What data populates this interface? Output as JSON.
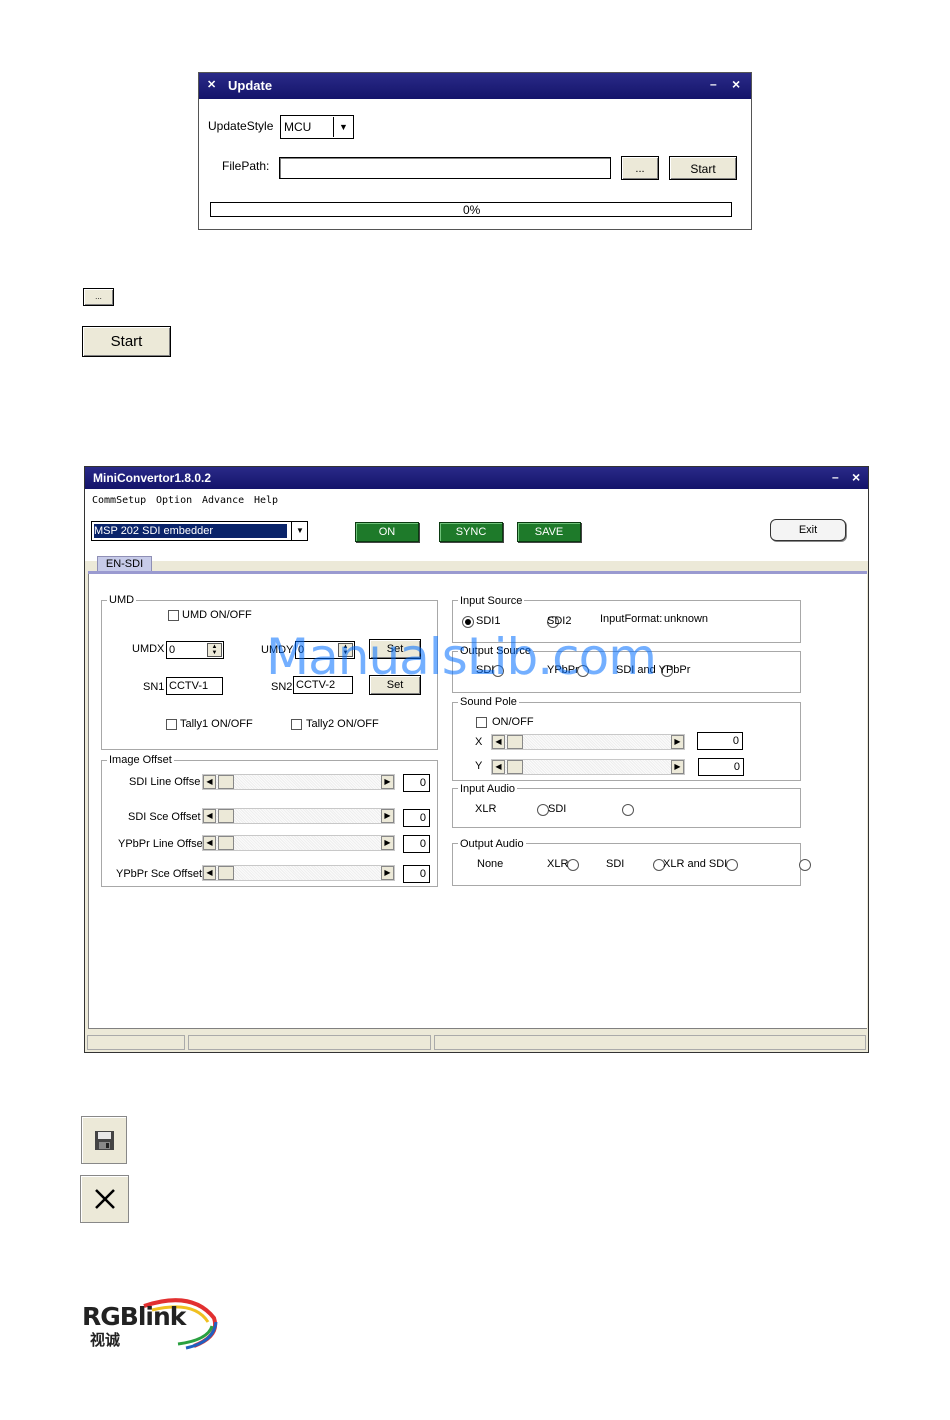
{
  "update_window": {
    "title": "Update",
    "minimize": "–",
    "close": "×",
    "update_style_label": "UpdateStyle",
    "update_style_value": "MCU",
    "file_path_label": "FilePath:",
    "file_path_value": "",
    "browse_label": "...",
    "start_label": "Start",
    "progress_text": "0%",
    "progress_value": 0
  },
  "legend_icons": {
    "browse_label": "...",
    "start_label": "Start"
  },
  "main_window": {
    "title": "MiniConvertor1.8.0.2",
    "minimize": "–",
    "close": "×",
    "menu": [
      "CommSetup",
      "Option",
      "Advance",
      "Help"
    ],
    "device_select": "MSP 202 SDI embedder",
    "buttons": {
      "on": "ON",
      "sync": "SYNC",
      "save": "SAVE",
      "exit": "Exit"
    },
    "tab": "EN-SDI",
    "umd": {
      "title": "UMD",
      "onoff": "UMD ON/OFF",
      "umdx_label": "UMDX",
      "umdx_value": "0",
      "umdy_label": "UMDY",
      "umdy_value": "0",
      "set1": "Set",
      "sn1_label": "SN1",
      "sn1_value": "CCTV-1",
      "sn2_label": "SN2",
      "sn2_value": "CCTV-2",
      "set2": "Set",
      "tally1": "Tally1 ON/OFF",
      "tally2": "Tally2 ON/OFF"
    },
    "image_offset": {
      "title": "Image Offset",
      "rows": [
        {
          "label": "SDI Line Offse",
          "value": "0"
        },
        {
          "label": "SDI Sce Offset",
          "value": "0"
        },
        {
          "label": "YPbPr Line Offse",
          "value": "0"
        },
        {
          "label": "YPbPr Sce Offset",
          "value": "0"
        }
      ]
    },
    "input_source": {
      "title": "Input Source",
      "opt1": "SDI1",
      "opt2": "SDI2",
      "format_label": "InputFormat:",
      "format_value": "unknown"
    },
    "output_source": {
      "title": "Output Source",
      "opt1": "SDI",
      "opt2": "YPbPr",
      "opt3": "SDI and YPbPr"
    },
    "sound_pole": {
      "title": "Sound Pole",
      "onoff": "ON/OFF",
      "x_label": "X",
      "x_value": "0",
      "y_label": "Y",
      "y_value": "0"
    },
    "input_audio": {
      "title": "Input Audio",
      "opt1": "XLR",
      "opt2": "SDI"
    },
    "output_audio": {
      "title": "Output Audio",
      "opt1": "None",
      "opt2": "XLR",
      "opt3": "SDI",
      "opt4": "XLR and SDI"
    }
  },
  "watermark": "ManualsLib.com",
  "logo": {
    "text": "RGBlink",
    "sub": "视诚"
  }
}
